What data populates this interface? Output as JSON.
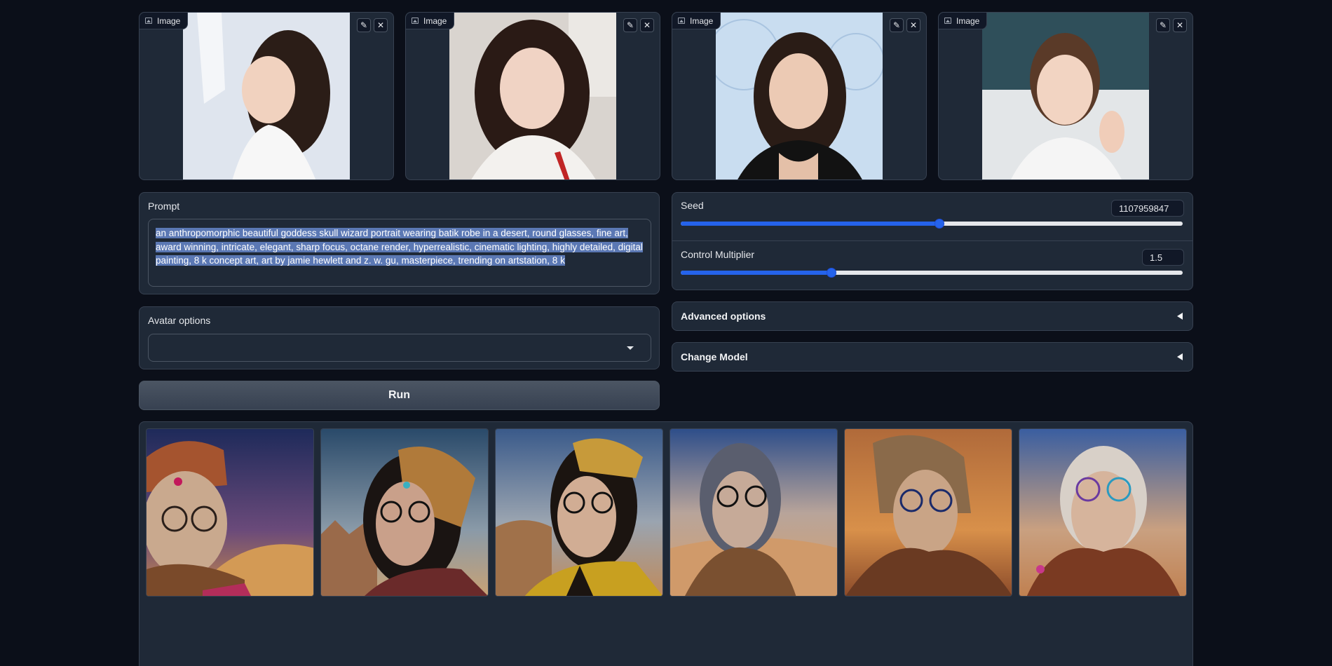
{
  "uploads": [
    {
      "label": "Image",
      "edit_icon": "pencil-icon",
      "clear_icon": "close-icon"
    },
    {
      "label": "Image",
      "edit_icon": "pencil-icon",
      "clear_icon": "close-icon"
    },
    {
      "label": "Image",
      "edit_icon": "pencil-icon",
      "clear_icon": "close-icon"
    },
    {
      "label": "Image",
      "edit_icon": "pencil-icon",
      "clear_icon": "close-icon"
    }
  ],
  "prompt": {
    "label": "Prompt",
    "value": "an anthropomorphic beautiful goddess skull wizard portrait wearing batik robe in a desert, round glasses, fine art, award winning, intricate, elegant, sharp focus, octane render, hyperrealistic, cinematic lighting, highly detailed, digital painting, 8 k concept art, art by jamie hewlett and z. w. gu, masterpiece, trending on artstation, 8 k"
  },
  "avatar": {
    "label": "Avatar options",
    "value": ""
  },
  "run_label": "Run",
  "seed": {
    "label": "Seed",
    "value": "1107959847",
    "fraction": 0.516
  },
  "control": {
    "label": "Control Multiplier",
    "value": "1.5",
    "fraction": 0.3
  },
  "advanced": {
    "label": "Advanced options"
  },
  "change_model": {
    "label": "Change Model"
  },
  "colors": {
    "accent": "#2563eb",
    "background": "#0b0f19",
    "panel": "#1f2937",
    "border": "#374151"
  }
}
